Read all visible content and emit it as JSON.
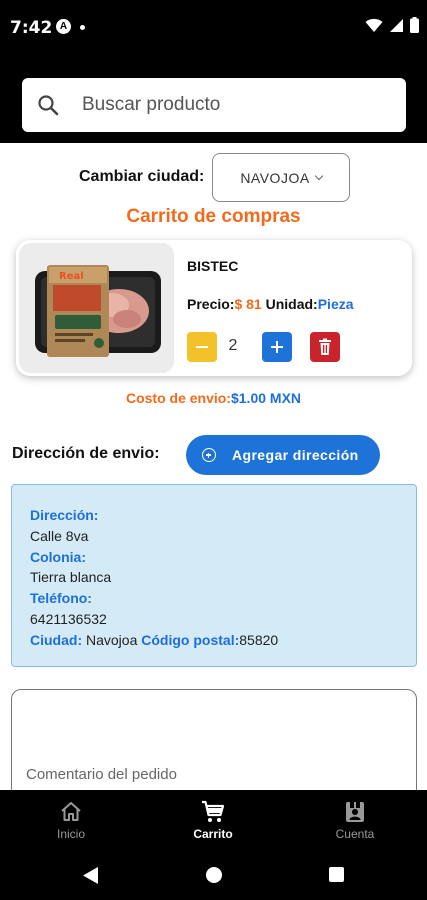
{
  "status_bar": {
    "time": "7:42",
    "app_badge": "A"
  },
  "search": {
    "placeholder": "Buscar producto"
  },
  "city": {
    "label": "Cambiar ciudad:",
    "selected": "NAVOJOA"
  },
  "cart": {
    "title": "Carrito de compras"
  },
  "product": {
    "name": "BISTEC",
    "price_label": "Precio:",
    "price": "$ 81",
    "unit_label": "Unidad:",
    "unit": "Pieza",
    "quantity": "2",
    "image_icon": "meat-package-image"
  },
  "shipping": {
    "label": "Costo de envio:",
    "value": "$1.00 MXN"
  },
  "address": {
    "label": "Dirección de envio:",
    "add_button": "Agregar dirección",
    "direccion_label": "Dirección:",
    "direccion": "Calle 8va",
    "colonia_label": "Colonia:",
    "colonia": "Tierra blanca",
    "telefono_label": "Teléfono:",
    "telefono": "6421136532",
    "ciudad_label": "Ciudad:",
    "ciudad": "Navojoa",
    "cp_label": "Código postal:",
    "cp": "85820"
  },
  "comment": {
    "placeholder": "Comentario del pedido"
  },
  "bottom_nav": {
    "items": [
      {
        "label": "Inicio",
        "icon": "home-icon",
        "active": false
      },
      {
        "label": "Carrito",
        "icon": "cart-icon",
        "active": true
      },
      {
        "label": "Cuenta",
        "icon": "account-icon",
        "active": false
      }
    ]
  },
  "colors": {
    "accent_orange": "#f26b1d",
    "accent_blue": "#1e73d8",
    "minus_yellow": "#f3c12a",
    "delete_red": "#c9242b",
    "address_bg": "#d4ebf7"
  }
}
